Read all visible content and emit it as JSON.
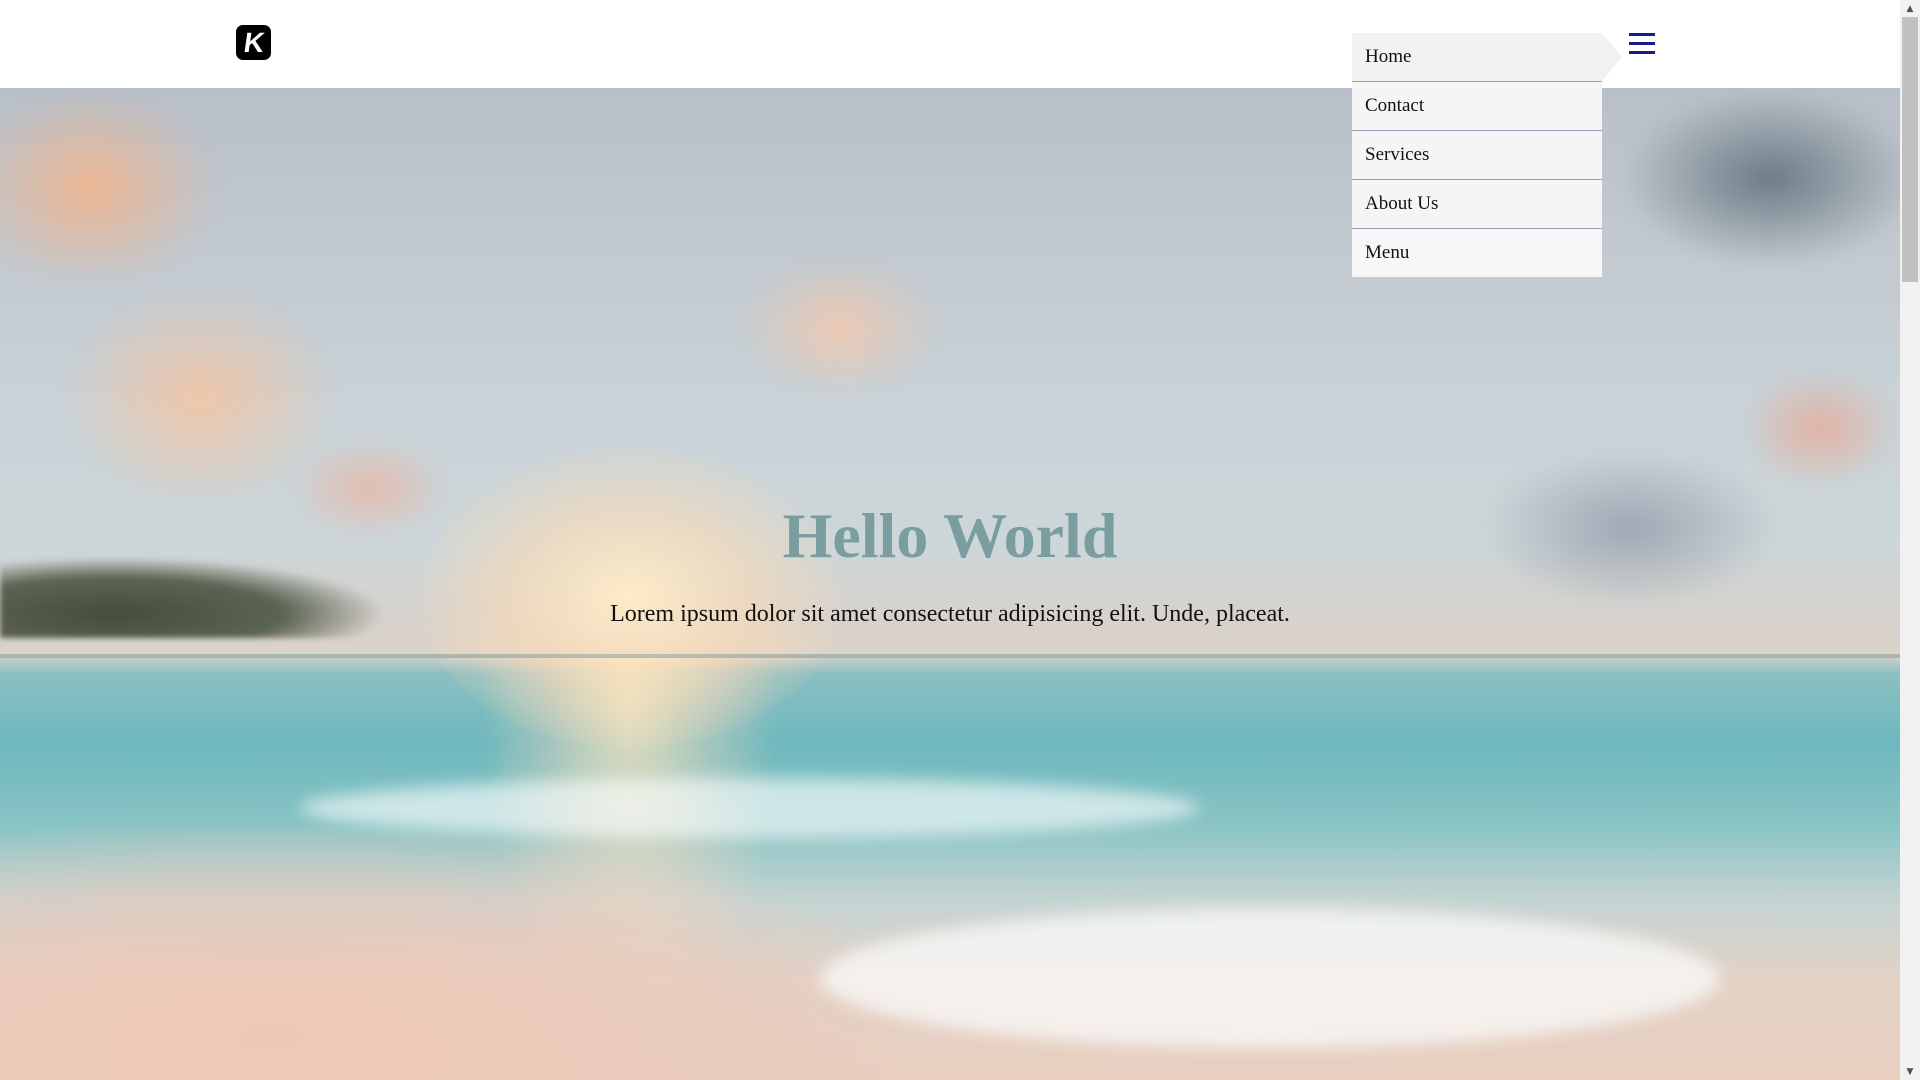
{
  "brand": {
    "logo_letter": "K"
  },
  "menu_button": {
    "icon": "hamburger-icon",
    "color": "#1a1a8f"
  },
  "dropdown": {
    "items": [
      {
        "label": "Home"
      },
      {
        "label": "Contact"
      },
      {
        "label": "Services"
      },
      {
        "label": "About Us"
      },
      {
        "label": "Menu"
      }
    ]
  },
  "hero": {
    "title": "Hello World",
    "subtitle": "Lorem ipsum dolor sit amet consectetur adipisicing elit. Unde, placeat.",
    "title_color": "#7a9e9f",
    "background": "beach-sunset-image"
  }
}
